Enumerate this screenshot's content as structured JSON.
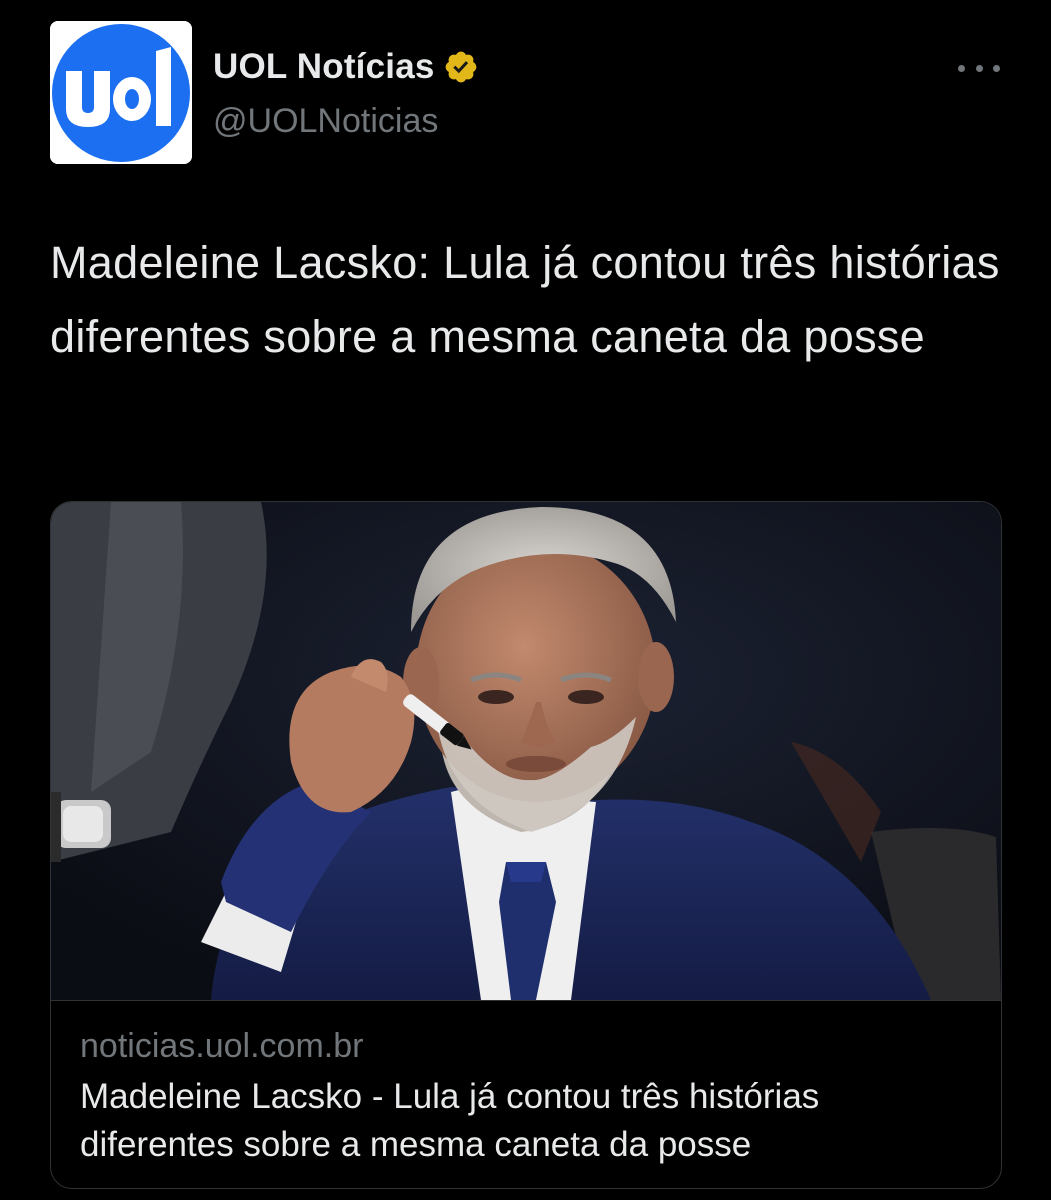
{
  "author": {
    "display_name": "UOL Notícias",
    "handle": "@UOLNoticias",
    "verified_icon": "verified-badge-icon",
    "avatar_logo_text": "uol",
    "colors": {
      "avatar_blue": "#1b6ff0",
      "verified_gold": "#e2b719"
    }
  },
  "tweet": {
    "text": "Madeleine Lacsko: Lula já contou três histórias diferentes sobre a mesma caneta da posse"
  },
  "link_card": {
    "domain": "noticias.uol.com.br",
    "title": "Madeleine Lacsko - Lula já contou três histórias diferentes sobre a mesma caneta da posse"
  },
  "icons": {
    "more_options": "more-horizontal-icon"
  }
}
